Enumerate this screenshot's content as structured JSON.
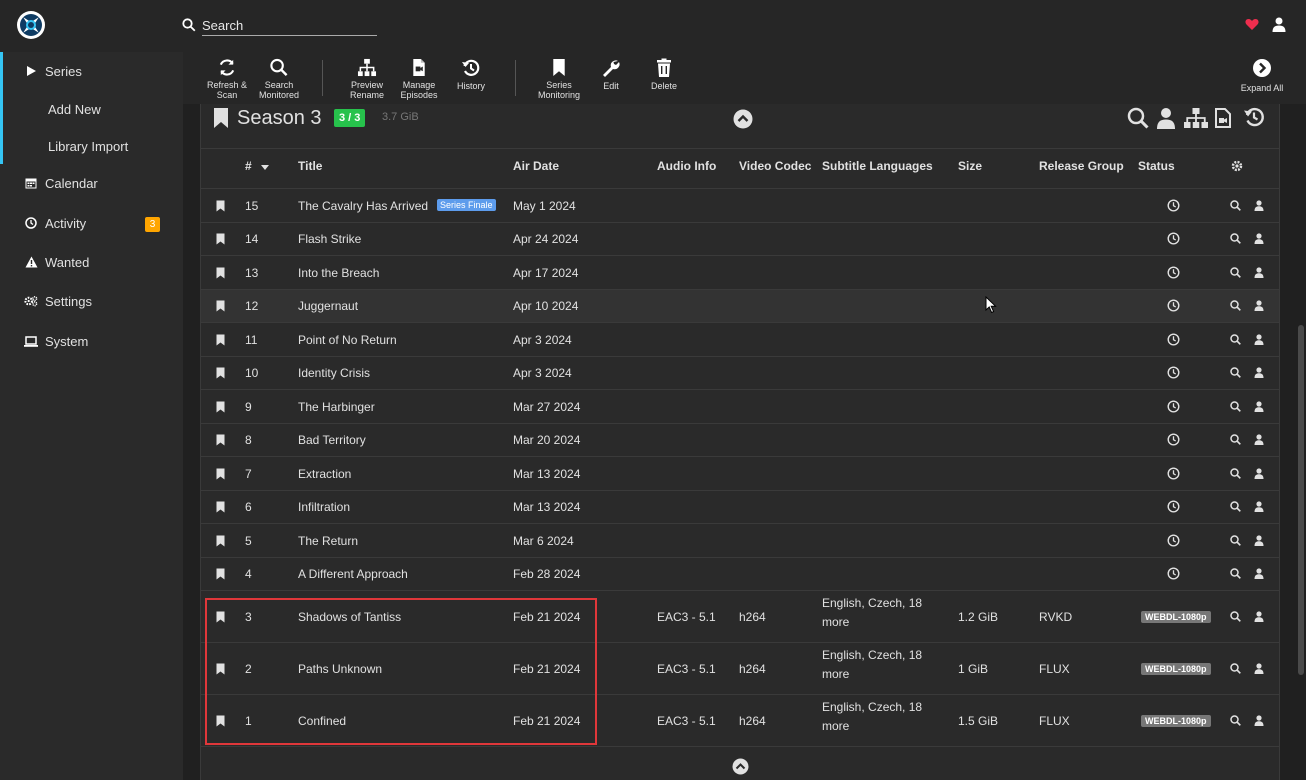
{
  "header": {
    "search_placeholder": "Search"
  },
  "sidebar": {
    "items": [
      {
        "label": "Series",
        "name": "sidebar-item-series"
      },
      {
        "label": "Add New",
        "name": "sidebar-item-add-new"
      },
      {
        "label": "Library Import",
        "name": "sidebar-item-library-import"
      },
      {
        "label": "Calendar",
        "name": "sidebar-item-calendar"
      },
      {
        "label": "Activity",
        "name": "sidebar-item-activity",
        "badge": "3"
      },
      {
        "label": "Wanted",
        "name": "sidebar-item-wanted"
      },
      {
        "label": "Settings",
        "name": "sidebar-item-settings"
      },
      {
        "label": "System",
        "name": "sidebar-item-system"
      }
    ]
  },
  "toolbar": {
    "refresh_1": "Refresh &",
    "refresh_2": "Scan",
    "search_1": "Search",
    "search_2": "Monitored",
    "preview_1": "Preview",
    "preview_2": "Rename",
    "manage_1": "Manage",
    "manage_2": "Episodes",
    "history": "History",
    "monitoring_1": "Series",
    "monitoring_2": "Monitoring",
    "edit": "Edit",
    "delete": "Delete",
    "expand_all": "Expand All"
  },
  "season": {
    "title": "Season 3",
    "badge": "3 / 3",
    "size": "3.7 GiB"
  },
  "table": {
    "headers": {
      "number": "#",
      "title": "Title",
      "air_date": "Air Date",
      "audio": "Audio Info",
      "video": "Video Codec",
      "subtitles": "Subtitle Languages",
      "size": "Size",
      "release_group": "Release Group",
      "status": "Status"
    },
    "rows": [
      {
        "num": "15",
        "title": "The Cavalry Has Arrived",
        "tag": "Series Finale",
        "air": "May 1 2024"
      },
      {
        "num": "14",
        "title": "Flash Strike",
        "air": "Apr 24 2024"
      },
      {
        "num": "13",
        "title": "Into the Breach",
        "air": "Apr 17 2024"
      },
      {
        "num": "12",
        "title": "Juggernaut",
        "air": "Apr 10 2024"
      },
      {
        "num": "11",
        "title": "Point of No Return",
        "air": "Apr 3 2024"
      },
      {
        "num": "10",
        "title": "Identity Crisis",
        "air": "Apr 3 2024"
      },
      {
        "num": "9",
        "title": "The Harbinger",
        "air": "Mar 27 2024"
      },
      {
        "num": "8",
        "title": "Bad Territory",
        "air": "Mar 20 2024"
      },
      {
        "num": "7",
        "title": "Extraction",
        "air": "Mar 13 2024"
      },
      {
        "num": "6",
        "title": "Infiltration",
        "air": "Mar 13 2024"
      },
      {
        "num": "5",
        "title": "The Return",
        "air": "Mar 6 2024"
      },
      {
        "num": "4",
        "title": "A Different Approach",
        "air": "Feb 28 2024"
      },
      {
        "num": "3",
        "title": "Shadows of Tantiss",
        "air": "Feb 21 2024",
        "audio": "EAC3 - 5.1",
        "video": "h264",
        "subs1": "English, Czech, 18",
        "subs2": "more",
        "size": "1.2 GiB",
        "group": "RVKD",
        "quality": "WEBDL-1080p"
      },
      {
        "num": "2",
        "title": "Paths Unknown",
        "air": "Feb 21 2024",
        "audio": "EAC3 - 5.1",
        "video": "h264",
        "subs1": "English, Czech, 18",
        "subs2": "more",
        "size": "1 GiB",
        "group": "FLUX",
        "quality": "WEBDL-1080p"
      },
      {
        "num": "1",
        "title": "Confined",
        "air": "Feb 21 2024",
        "audio": "EAC3 - 5.1",
        "video": "h264",
        "subs1": "English, Czech, 18",
        "subs2": "more",
        "size": "1.5 GiB",
        "group": "FLUX",
        "quality": "WEBDL-1080p"
      }
    ]
  },
  "colors": {
    "accent": "#35c5f4",
    "success": "#27c24c",
    "warning": "#ffa500",
    "finale_tag": "#5d9cec",
    "annotation": "#e0373a",
    "heart": "#ee2e4e"
  }
}
